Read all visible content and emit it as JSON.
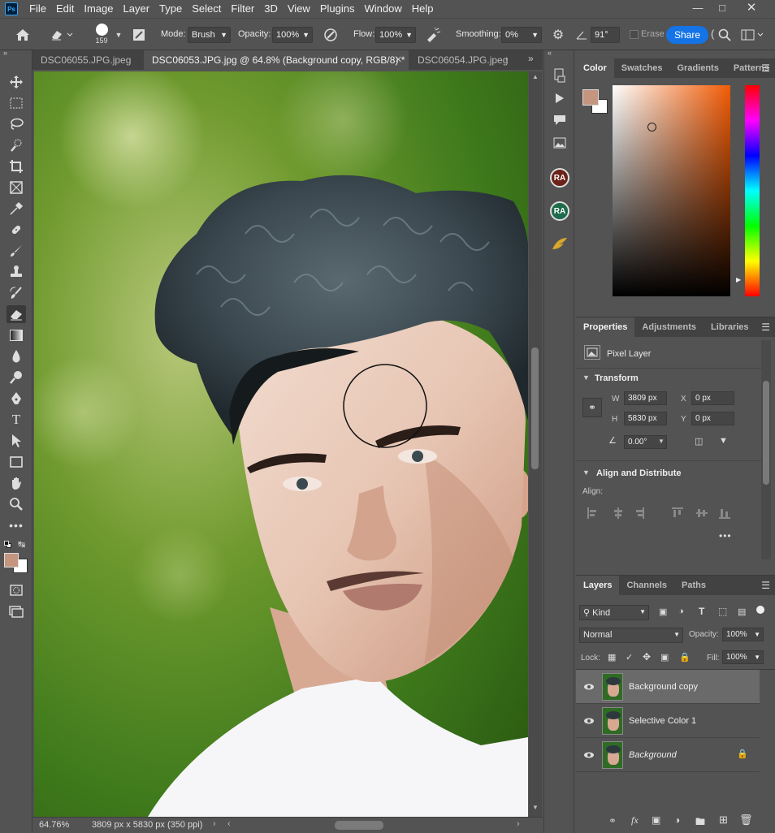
{
  "menu": [
    "File",
    "Edit",
    "Image",
    "Layer",
    "Type",
    "Select",
    "Filter",
    "3D",
    "View",
    "Plugins",
    "Window",
    "Help"
  ],
  "app_logo": "Ps",
  "options": {
    "brush_size": "159",
    "mode_label": "Mode:",
    "mode_value": "Brush",
    "opacity_label": "Opacity:",
    "opacity_value": "100%",
    "flow_label": "Flow:",
    "flow_value": "100%",
    "smoothing_label": "Smoothing:",
    "smoothing_value": "0%",
    "angle_value": "91°",
    "erase_history_label": "Erase t",
    "share_label": "Share"
  },
  "tabs": [
    {
      "label": "DSC06055.JPG.jpeg"
    },
    {
      "label": "DSC06053.JPG.jpg @ 64.8% (Background copy, RGB/8) *"
    },
    {
      "label": "DSC06054.JPG.jpeg"
    }
  ],
  "status": {
    "zoom": "64.76%",
    "doc_info": "3809 px x 5830 px (350 ppi)"
  },
  "colors": {
    "foreground": "#c4957f",
    "background": "#ffffff",
    "accent": "#1473e6"
  },
  "color_panel": {
    "tabs": [
      "Color",
      "Swatches",
      "Gradients",
      "Patterns"
    ]
  },
  "properties_panel": {
    "tabs": [
      "Properties",
      "Adjustments",
      "Libraries"
    ],
    "layer_type": "Pixel Layer",
    "transform_title": "Transform",
    "w_label": "W",
    "w_value": "3809 px",
    "h_label": "H",
    "h_value": "5830 px",
    "x_label": "X",
    "x_value": "0 px",
    "y_label": "Y",
    "y_value": "0 px",
    "angle_value": "0.00°",
    "align_title": "Align and Distribute",
    "align_label": "Align:"
  },
  "layers_panel": {
    "tabs": [
      "Layers",
      "Channels",
      "Paths"
    ],
    "kind_label": "Kind",
    "blend_mode": "Normal",
    "opacity_label": "Opacity:",
    "opacity_value": "100%",
    "lock_label": "Lock:",
    "fill_label": "Fill:",
    "fill_value": "100%",
    "layers": [
      {
        "name": "Background copy",
        "selected": true
      },
      {
        "name": "Selective Color 1",
        "selected": false
      },
      {
        "name": "Background",
        "selected": false
      }
    ]
  },
  "mini_icons": [
    "RA",
    "RA"
  ]
}
